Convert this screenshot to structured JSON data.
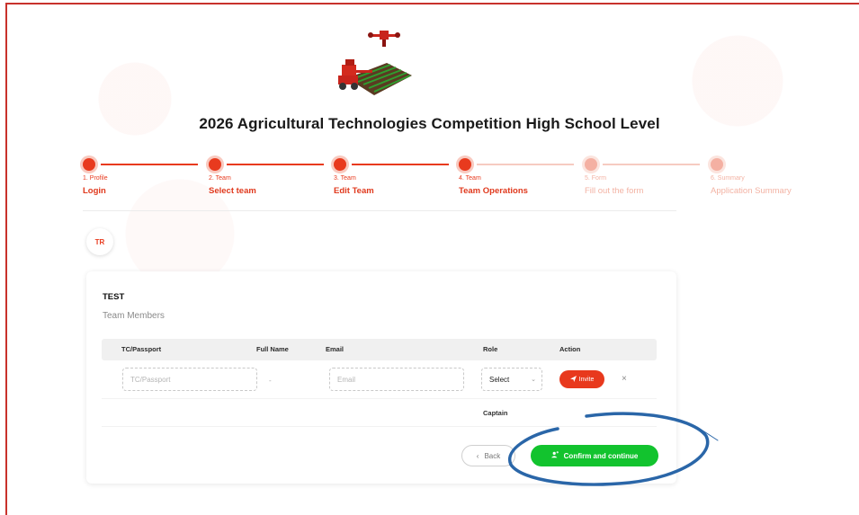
{
  "page": {
    "title": "2026 Agricultural Technologies Competition High School Level"
  },
  "stepper": [
    {
      "small": "1. Profile",
      "label": "Login",
      "state": "done"
    },
    {
      "small": "2. Team",
      "label": "Select team",
      "state": "done"
    },
    {
      "small": "3. Team",
      "label": "Edit Team",
      "state": "done"
    },
    {
      "small": "4. Team",
      "label": "Team Operations",
      "state": "active"
    },
    {
      "small": "5. Form",
      "label": "Fill out the form",
      "state": "pending"
    },
    {
      "small": "6. Summary",
      "label": "Application Summary",
      "state": "pending"
    }
  ],
  "avatar": {
    "initials": "TR"
  },
  "team": {
    "name": "TEST",
    "members_label": "Team Members"
  },
  "table": {
    "headers": [
      "TC/Passport",
      "Full Name",
      "Email",
      "Role",
      "Action"
    ],
    "new_row": {
      "tc_placeholder": "TC/Passport",
      "fullname": "-",
      "email_placeholder": "Email",
      "role_selected": "Select",
      "invite_label": "Invite",
      "remove_glyph": "×"
    },
    "rows": [
      {
        "role": "Captain"
      }
    ]
  },
  "buttons": {
    "back_label": "Back",
    "confirm_label": "Confirm and continue"
  },
  "colors": {
    "accent": "#e83a1e",
    "confirm": "#12c32e",
    "annotation": "#2a66a8",
    "frame": "#c8322c"
  },
  "icons": [
    "robot-planter-logo",
    "send-icon",
    "close-icon",
    "chevron-left-icon",
    "user-plus-icon",
    "chevron-down-icon"
  ]
}
